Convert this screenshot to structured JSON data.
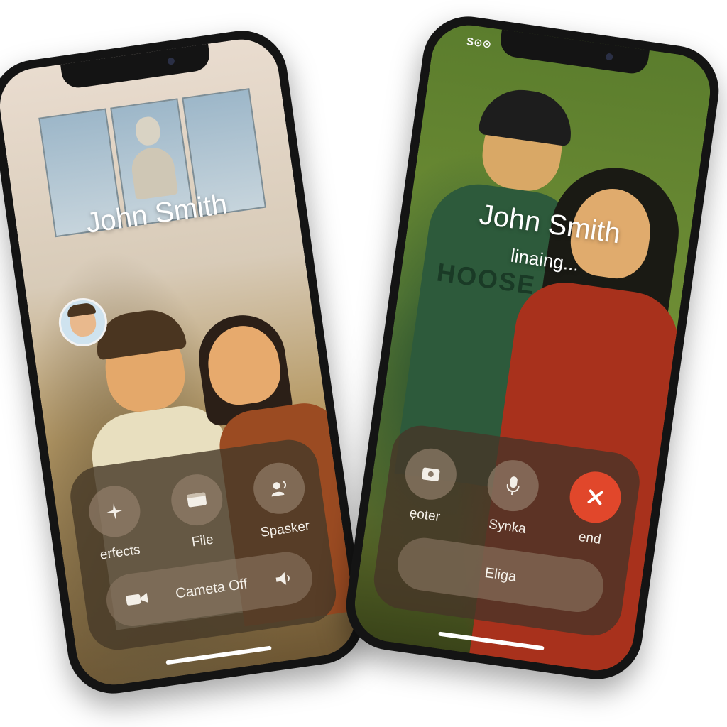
{
  "left_phone": {
    "caller_name": "John Smith",
    "controls": {
      "effects_label": "erfects",
      "file_label": "File",
      "speaker_label": "Spasker",
      "camera_off_label": "Cameta Off"
    }
  },
  "right_phone": {
    "status_bar_text": "S⊙⊙",
    "caller_name": "John Smith",
    "call_status": "linaing...",
    "hoodie_text": "HOOSE",
    "controls": {
      "first_label": "ẹoter",
      "mic_label": "Synka",
      "end_label": "end",
      "bottom_label": "Eliga"
    },
    "colors": {
      "end_button": "#e1472b"
    }
  }
}
